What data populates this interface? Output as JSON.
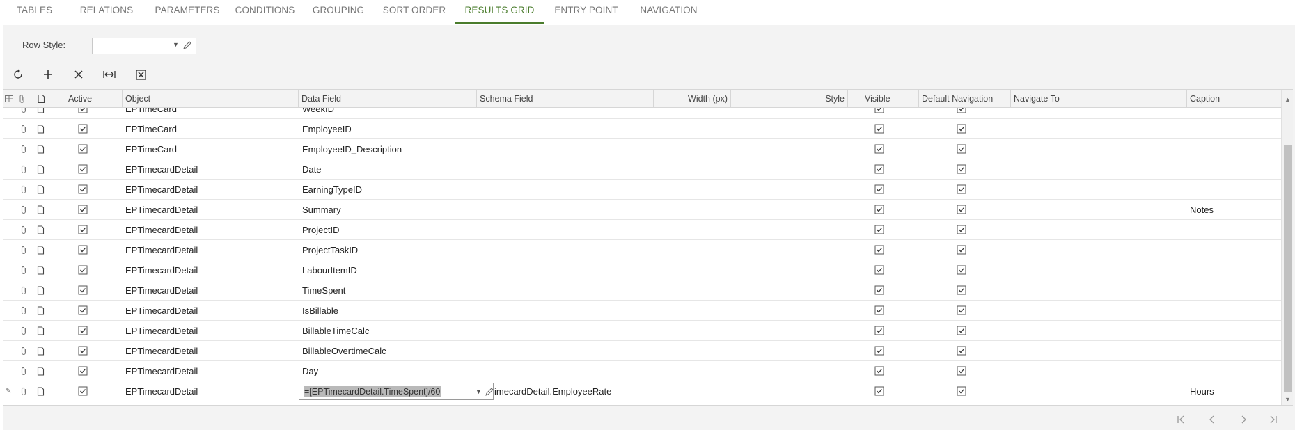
{
  "tabs": [
    {
      "label": "TABLES",
      "active": false
    },
    {
      "label": "RELATIONS",
      "active": false
    },
    {
      "label": "PARAMETERS",
      "active": false
    },
    {
      "label": "CONDITIONS",
      "active": false
    },
    {
      "label": "GROUPING",
      "active": false
    },
    {
      "label": "SORT ORDER",
      "active": false
    },
    {
      "label": "RESULTS GRID",
      "active": true
    },
    {
      "label": "ENTRY POINT",
      "active": false
    },
    {
      "label": "NAVIGATION",
      "active": false
    }
  ],
  "form": {
    "row_style_label": "Row Style:",
    "row_style_value": ""
  },
  "toolbar": {
    "refresh": "refresh-icon",
    "add": "plus-icon",
    "delete": "close-icon",
    "fit": "fit-columns-icon",
    "export": "excel-export-icon"
  },
  "grid": {
    "columns": {
      "active": "Active",
      "object": "Object",
      "data_field": "Data Field",
      "schema_field": "Schema Field",
      "width": "Width (px)",
      "style": "Style",
      "visible": "Visible",
      "default_navigation": "Default Navigation",
      "navigate_to": "Navigate To",
      "caption": "Caption"
    },
    "rows": [
      {
        "object": "EPTimeCard",
        "data_field": "WeekID",
        "schema_field": "",
        "caption": "",
        "active": true,
        "visible": true,
        "default_nav": true
      },
      {
        "object": "EPTimeCard",
        "data_field": "EmployeeID",
        "schema_field": "",
        "caption": "",
        "active": true,
        "visible": true,
        "default_nav": true
      },
      {
        "object": "EPTimeCard",
        "data_field": "EmployeeID_Description",
        "schema_field": "",
        "caption": "",
        "active": true,
        "visible": true,
        "default_nav": true
      },
      {
        "object": "EPTimecardDetail",
        "data_field": "Date",
        "schema_field": "",
        "caption": "",
        "active": true,
        "visible": true,
        "default_nav": true
      },
      {
        "object": "EPTimecardDetail",
        "data_field": "EarningTypeID",
        "schema_field": "",
        "caption": "",
        "active": true,
        "visible": true,
        "default_nav": true
      },
      {
        "object": "EPTimecardDetail",
        "data_field": "Summary",
        "schema_field": "",
        "caption": "Notes",
        "active": true,
        "visible": true,
        "default_nav": true
      },
      {
        "object": "EPTimecardDetail",
        "data_field": "ProjectID",
        "schema_field": "",
        "caption": "",
        "active": true,
        "visible": true,
        "default_nav": true
      },
      {
        "object": "EPTimecardDetail",
        "data_field": "ProjectTaskID",
        "schema_field": "",
        "caption": "",
        "active": true,
        "visible": true,
        "default_nav": true
      },
      {
        "object": "EPTimecardDetail",
        "data_field": "LabourItemID",
        "schema_field": "",
        "caption": "",
        "active": true,
        "visible": true,
        "default_nav": true
      },
      {
        "object": "EPTimecardDetail",
        "data_field": "TimeSpent",
        "schema_field": "",
        "caption": "",
        "active": true,
        "visible": true,
        "default_nav": true
      },
      {
        "object": "EPTimecardDetail",
        "data_field": "IsBillable",
        "schema_field": "",
        "caption": "",
        "active": true,
        "visible": true,
        "default_nav": true
      },
      {
        "object": "EPTimecardDetail",
        "data_field": "BillableTimeCalc",
        "schema_field": "",
        "caption": "",
        "active": true,
        "visible": true,
        "default_nav": true
      },
      {
        "object": "EPTimecardDetail",
        "data_field": "BillableOvertimeCalc",
        "schema_field": "",
        "caption": "",
        "active": true,
        "visible": true,
        "default_nav": true
      },
      {
        "object": "EPTimecardDetail",
        "data_field": "Day",
        "schema_field": "",
        "caption": "",
        "active": true,
        "visible": true,
        "default_nav": true
      },
      {
        "object": "EPTimecardDetail",
        "data_field": "=[EPTimecardDetail.TimeSpent]/60",
        "schema_field": "imecardDetail.EmployeeRate",
        "caption": "Hours",
        "active": true,
        "visible": true,
        "default_nav": true,
        "editing": true
      }
    ]
  },
  "pager": {
    "first": "first-page-icon",
    "prev": "prev-page-icon",
    "next": "next-page-icon",
    "last": "last-page-icon"
  }
}
